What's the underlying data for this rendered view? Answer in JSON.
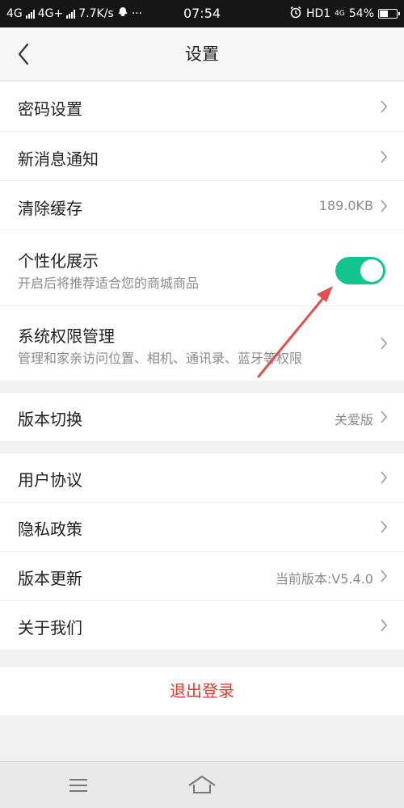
{
  "status_bar": {
    "left_text_1": "4G",
    "left_text_2": "4G+",
    "net_speed": "7.7K/s",
    "dots": "···",
    "time": "07:54",
    "hd": "HD1",
    "net_small": "4G",
    "battery_percent": "54%",
    "battery_level": 0.54
  },
  "header": {
    "title": "设置"
  },
  "settings": {
    "password": {
      "label": "密码设置"
    },
    "notifications": {
      "label": "新消息通知"
    },
    "clear_cache": {
      "label": "清除缓存",
      "value": "189.0KB"
    },
    "personalized": {
      "label": "个性化展示",
      "sub": "开启后将推荐适合您的商城商品",
      "enabled": true
    },
    "permissions": {
      "label": "系统权限管理",
      "sub": "管理和家亲访问位置、相机、通讯录、蓝牙等权限"
    },
    "version_switch": {
      "label": "版本切换",
      "value": "关爱版"
    },
    "user_agreement": {
      "label": "用户协议"
    },
    "privacy_policy": {
      "label": "隐私政策"
    },
    "version_update": {
      "label": "版本更新",
      "value": "当前版本:V5.4.0"
    },
    "about": {
      "label": "关于我们"
    }
  },
  "logout": {
    "label": "退出登录"
  },
  "colors": {
    "accent": "#14c48e",
    "logout": "#e23a2e",
    "arrow": "#e05050"
  },
  "icons": [
    "back-icon",
    "chevron-right-icon",
    "menu-icon",
    "home-icon",
    "alarm-icon",
    "qq-icon"
  ]
}
